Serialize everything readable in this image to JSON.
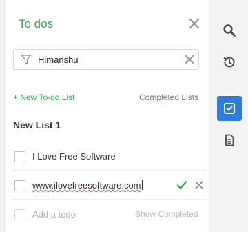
{
  "header": {
    "title": "To dos"
  },
  "filter": {
    "value": "Himanshu"
  },
  "actions": {
    "new_list": "+ New To-do List",
    "completed_lists": "Completed Lists"
  },
  "list": {
    "name": "New List 1",
    "items": [
      {
        "text": "I Love Free Software"
      },
      {
        "text": "www.ilovefreesoftware.com"
      }
    ],
    "add_placeholder": "Add a todo",
    "show_completed": "Show Completed"
  },
  "colors": {
    "accent_green": "#34a853",
    "active_blue": "#2d7de0"
  },
  "rail": {
    "icons": [
      "search-icon",
      "history-icon",
      "todo-check-icon",
      "notes-icon"
    ]
  }
}
